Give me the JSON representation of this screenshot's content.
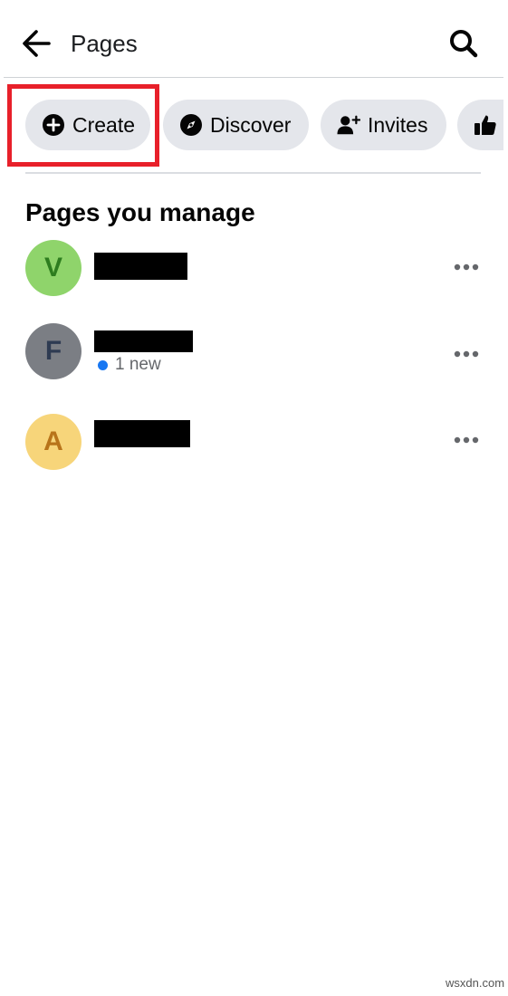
{
  "header": {
    "back_icon": "arrow-left-icon",
    "title": "Pages",
    "search_icon": "search-icon"
  },
  "chips": [
    {
      "label": "Create",
      "icon": "plus-circle-icon"
    },
    {
      "label": "Discover",
      "icon": "compass-icon"
    },
    {
      "label": "Invites",
      "icon": "person-add-icon"
    },
    {
      "label": "",
      "icon": "thumbs-up-icon"
    }
  ],
  "highlight": {
    "target": "Create",
    "color": "#e8202a"
  },
  "section": {
    "title": "Pages you manage"
  },
  "pages": [
    {
      "avatar_letter": "V",
      "avatar_bg": "#8fd46b",
      "avatar_fg": "#2e7d1f",
      "subtitle": ""
    },
    {
      "avatar_letter": "F",
      "avatar_bg": "#7b7e84",
      "avatar_fg": "#2e3b52",
      "subtitle": "1 new"
    },
    {
      "avatar_letter": "A",
      "avatar_bg": "#f7d57a",
      "avatar_fg": "#b8741a",
      "subtitle": ""
    }
  ],
  "colors": {
    "chip_bg": "#e4e6eb",
    "new_dot": "#1877f2",
    "divider": "#cfd2d6"
  },
  "watermark": "wsxdn.com"
}
